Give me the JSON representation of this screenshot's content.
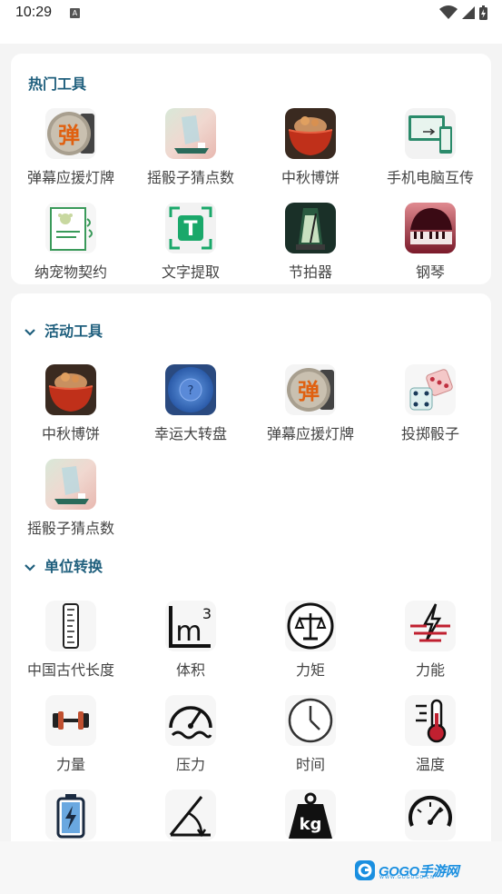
{
  "status": {
    "time": "10:29",
    "notif_letter": "A"
  },
  "hot": {
    "title": "热门工具",
    "items": [
      {
        "label": "弹幕应援灯牌",
        "icon": "danmu-icon"
      },
      {
        "label": "摇骰子猜点数",
        "icon": "dice-cup-icon"
      },
      {
        "label": "中秋博饼",
        "icon": "mooncake-bowl-icon"
      },
      {
        "label": "手机电脑互传",
        "icon": "phone-pc-transfer-icon"
      },
      {
        "label": "纳宠物契约",
        "icon": "pet-contract-icon"
      },
      {
        "label": "文字提取",
        "icon": "text-extract-icon"
      },
      {
        "label": "节拍器",
        "icon": "metronome-icon"
      },
      {
        "label": "钢琴",
        "icon": "piano-icon"
      }
    ]
  },
  "activity": {
    "title": "活动工具",
    "items": [
      {
        "label": "中秋博饼",
        "icon": "mooncake-bowl-icon"
      },
      {
        "label": "幸运大转盘",
        "icon": "lucky-wheel-icon"
      },
      {
        "label": "弹幕应援灯牌",
        "icon": "danmu-icon"
      },
      {
        "label": "投掷骰子",
        "icon": "dice-icon"
      },
      {
        "label": "摇骰子猜点数",
        "icon": "dice-cup-icon"
      }
    ]
  },
  "unit": {
    "title": "单位转换",
    "items": [
      {
        "label": "中国古代长度",
        "icon": "ruler-icon"
      },
      {
        "label": "体积",
        "icon": "volume-icon"
      },
      {
        "label": "力矩",
        "icon": "torque-icon"
      },
      {
        "label": "力能",
        "icon": "energy-icon"
      },
      {
        "label": "力量",
        "icon": "dumbbell-icon"
      },
      {
        "label": "压力",
        "icon": "pressure-gauge-icon"
      },
      {
        "label": "时间",
        "icon": "clock-icon"
      },
      {
        "label": "温度",
        "icon": "thermometer-icon"
      },
      {
        "label": "",
        "icon": "battery-icon"
      },
      {
        "label": "",
        "icon": "angle-icon"
      },
      {
        "label": "",
        "icon": "weight-icon"
      },
      {
        "label": "",
        "icon": "speedometer-icon"
      }
    ]
  },
  "watermark": {
    "brand": "GOGO手游网",
    "url": "WWW.GOGOGO.CN"
  }
}
